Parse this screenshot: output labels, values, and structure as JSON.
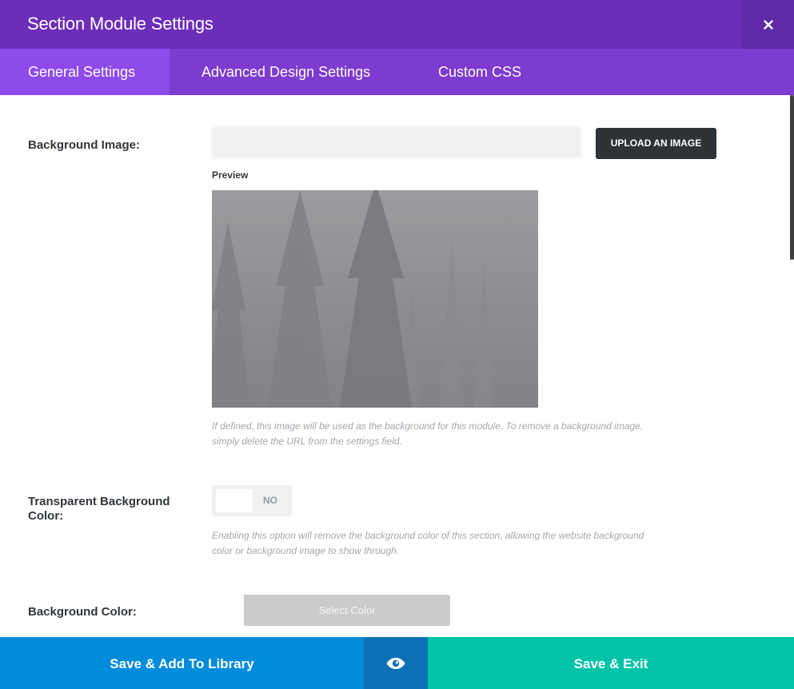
{
  "header": {
    "title": "Section Module Settings",
    "close_icon": "close-icon"
  },
  "tabs": [
    {
      "label": "General Settings",
      "active": true
    },
    {
      "label": "Advanced Design Settings",
      "active": false
    },
    {
      "label": "Custom CSS",
      "active": false
    }
  ],
  "background_image": {
    "label": "Background Image:",
    "upload_label": "UPLOAD AN IMAGE",
    "preview_label": "Preview",
    "description": "If defined, this image will be used as the background for this module. To remove a background image, simply delete the URL from the settings field."
  },
  "transparent_bg": {
    "label": "Transparent Background Color:",
    "value": "NO",
    "description": "Enabling this option will remove the background color of this section, allowing the website background color or background image to show through."
  },
  "background_color": {
    "label": "Background Color:",
    "button_label": "Select Color"
  },
  "footer": {
    "save_library_label": "Save & Add To Library",
    "preview_icon": "eye-icon",
    "save_exit_label": "Save & Exit"
  },
  "colors": {
    "header": "#6c2eb9",
    "tabs": "#7d3bcf",
    "active_tab": "#8e4bea",
    "library_button": "#008bdb",
    "preview_button": "#0a70b3",
    "exit_button": "#00c3aa"
  }
}
